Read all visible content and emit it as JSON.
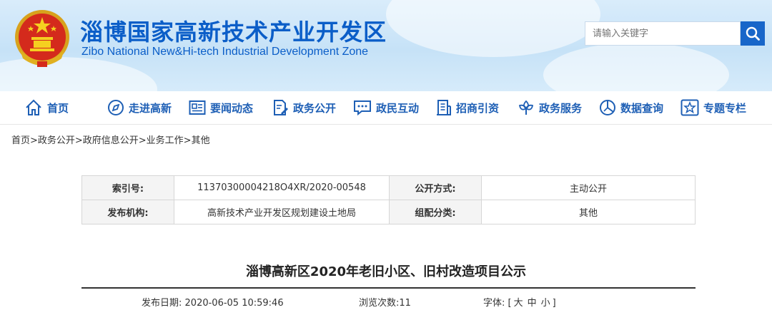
{
  "header": {
    "title_cn": "淄博国家高新技术产业开发区",
    "title_en": "Zibo National New&Hi-tech Industrial Development Zone",
    "search_placeholder": "请输入关键字",
    "brand_color": "#0b5ec8"
  },
  "nav": {
    "items": [
      {
        "label": "首页",
        "icon": "home-icon"
      },
      {
        "label": "走进高新",
        "icon": "compass-icon"
      },
      {
        "label": "要闻动态",
        "icon": "news-icon"
      },
      {
        "label": "政务公开",
        "icon": "document-edit-icon"
      },
      {
        "label": "政民互动",
        "icon": "chat-icon"
      },
      {
        "label": "招商引资",
        "icon": "building-icon"
      },
      {
        "label": "政务服务",
        "icon": "flower-icon"
      },
      {
        "label": "数据查询",
        "icon": "pie-chart-icon"
      },
      {
        "label": "专题专栏",
        "icon": "star-icon"
      }
    ]
  },
  "breadcrumb": "首页>政务公开>政府信息公开>业务工作>其他",
  "info": {
    "index_label": "索引号:",
    "index_value": "11370300004218O4XR/2020-00548",
    "open_label": "公开方式:",
    "open_value": "主动公开",
    "org_label": "发布机构:",
    "org_value": "高新技术产业开发区规划建设土地局",
    "category_label": "组配分类:",
    "category_value": "其他"
  },
  "article": {
    "title": "淄博高新区2020年老旧小区、旧村改造项目公示",
    "publish_label": "发布日期:",
    "publish_date": "2020-06-05 10:59:46",
    "views_label": "浏览次数:",
    "views": "11",
    "font_label": "字体:",
    "font_open": "[",
    "font_large": "大",
    "font_medium": "中",
    "font_small": "小",
    "font_close": "]"
  }
}
